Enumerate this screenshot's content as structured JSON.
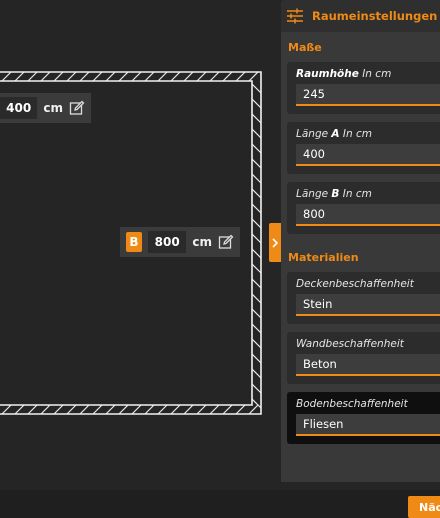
{
  "canvas": {
    "dimension_a": {
      "value": "400",
      "unit": "cm"
    },
    "dimension_b": {
      "letter": "B",
      "value": "800",
      "unit": "cm"
    }
  },
  "panel": {
    "title": "Raumeinstellungen",
    "icon": "sliders-icon",
    "section_dimensions": "Maße",
    "section_materials": "Materialien",
    "fields": {
      "raumhoehe": {
        "label_bold": "Raumhöhe",
        "label_rest": " In cm",
        "value": "245"
      },
      "laenge_a": {
        "label_prefix": "Länge ",
        "label_bold": "A",
        "label_rest": " In cm",
        "value": "400"
      },
      "laenge_b": {
        "label_prefix": "Länge ",
        "label_bold": "B",
        "label_rest": " In cm",
        "value": "800"
      },
      "decke": {
        "label": "Deckenbeschaffenheit",
        "value": "Stein"
      },
      "wand": {
        "label": "Wandbeschaffenheit",
        "value": "Beton"
      },
      "boden": {
        "label": "Bodenbeschaffenheit",
        "value": "Fliesen"
      }
    }
  },
  "footer": {
    "next_label": "Näc"
  },
  "colors": {
    "accent": "#ef8a17",
    "background": "#252525",
    "panel": "#393939"
  }
}
